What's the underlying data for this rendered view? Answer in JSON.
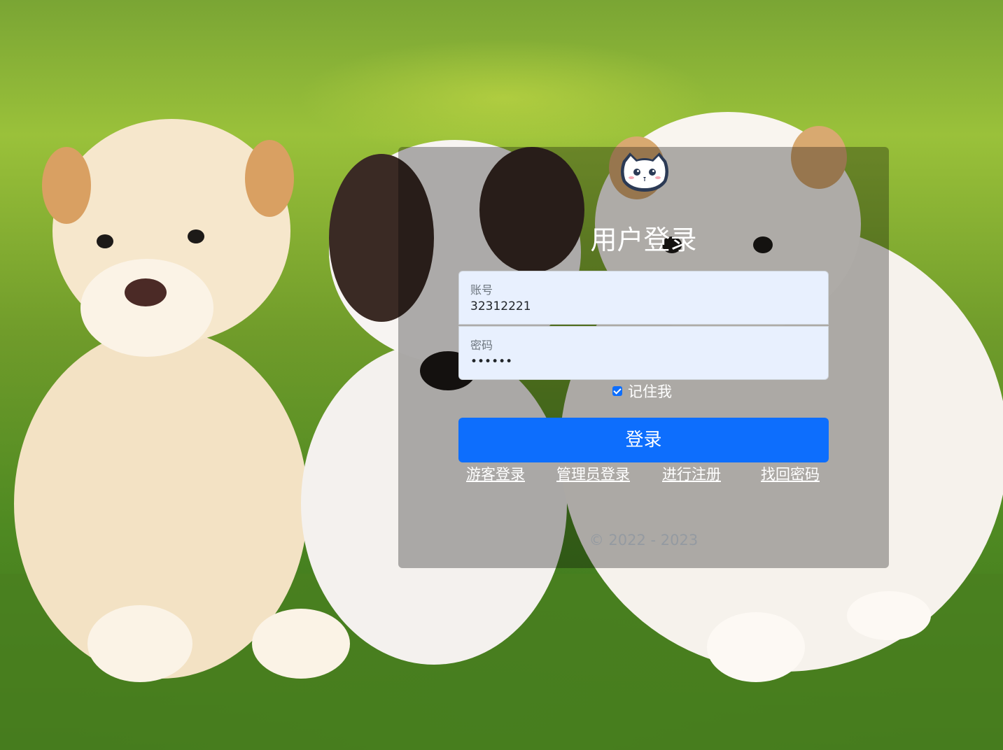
{
  "page": {
    "title": "用户登录"
  },
  "background": {
    "description_icon": "puppies-photo"
  },
  "form": {
    "account_label": "账号",
    "account_value": "32312221",
    "password_label": "密码",
    "password_value": "••••••",
    "remember_label": "记住我",
    "remember_checked": true,
    "login_button": "登录"
  },
  "links": {
    "guest_login": "游客登录",
    "admin_login": "管理员登录",
    "register": "进行注册",
    "recover_password": "找回密码"
  },
  "footer": {
    "copyright": "© 2022 - 2023"
  },
  "colors": {
    "primary": "#0d6efd",
    "input_bg": "#e8f0fe"
  }
}
